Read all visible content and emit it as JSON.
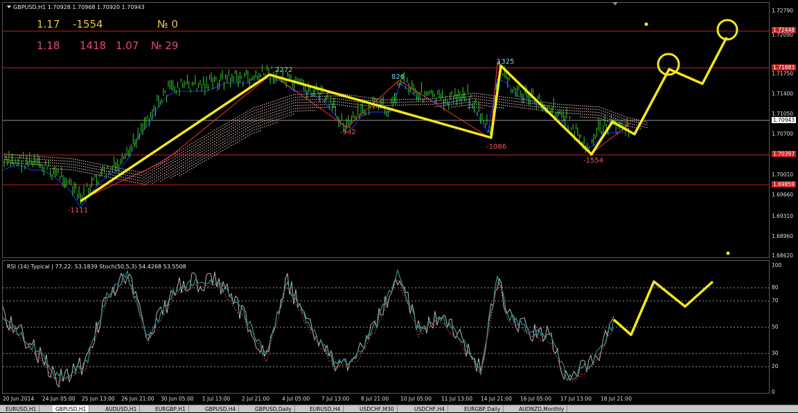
{
  "main_title": "GBPUSD,H1  1.70928 1.70968 1.70920 1.70943",
  "info_line1": [
    "1.17",
    "-1554",
    "№ 0"
  ],
  "info_line2": [
    "1.18",
    "1418",
    "1.07",
    "№ 29"
  ],
  "indicator_title": "RSI (14) Typical | 77,22: 53.1839  Stoch(50,5,3) 54.4268 53.5508",
  "price_axis": {
    "ticks": [
      "1.72790",
      "1.72090",
      "1.71750",
      "1.71400",
      "1.71050",
      "1.70700",
      "1.70010",
      "1.69660",
      "1.69310",
      "1.68960",
      "1.68620"
    ],
    "red_levels": [
      "1.72448",
      "1.71883",
      "1.70397",
      "1.69859"
    ],
    "current_price": "1.70943"
  },
  "ind_axis": {
    "ticks": [
      "100",
      "80",
      "70",
      "50",
      "30",
      "20",
      "0"
    ]
  },
  "time_axis": [
    "20 Jun 2014",
    "24 Jun 05:00",
    "25 Jun 13:00",
    "26 Jun 21:00",
    "30 Jun 05:00",
    "1 Jul 13:00",
    "2 Jul 21:00",
    "4 Jul 05:00",
    "7 Jul 13:00",
    "8 Jul 21:00",
    "10 Jul 05:00",
    "11 Jul 13:00",
    "14 Jul 21:00",
    "16 Jul 05:00",
    "17 Jul 13:00",
    "18 Jul 21:00"
  ],
  "zigzag_labels": [
    "-1111",
    "2272",
    "-942",
    "826",
    "1325",
    "-1086",
    "-1554"
  ],
  "tabs": [
    "EURUSD,H1",
    "GBPUSD,H1",
    "AUDUSD,H1",
    "EURGBP,H1",
    "GBPUSD,H4",
    "GBPUSD,Daily",
    "EURUSD,H4",
    "USDCHF,M30",
    "USDCHF,H4",
    "EURGBP,Daily",
    "AUDNZD,Monthly"
  ],
  "active_tab": "GBPUSD,H1",
  "colors": {
    "background": "#000000",
    "bars": "#33cc33",
    "level_lines": "#c4221f",
    "zigzag_thin": "#ff3333",
    "forecast_line": "#f5e81a",
    "cloud": "#e8c0c0",
    "kijun": "#1d38ff",
    "rsi_line": "#b4b4b4",
    "stoch_main": "#2f8f8f",
    "stoch_signal": "#e04040"
  },
  "icons": {
    "panel_menu": "triangle-down-icon",
    "scroll_marker": "triangle-down-icon"
  }
}
